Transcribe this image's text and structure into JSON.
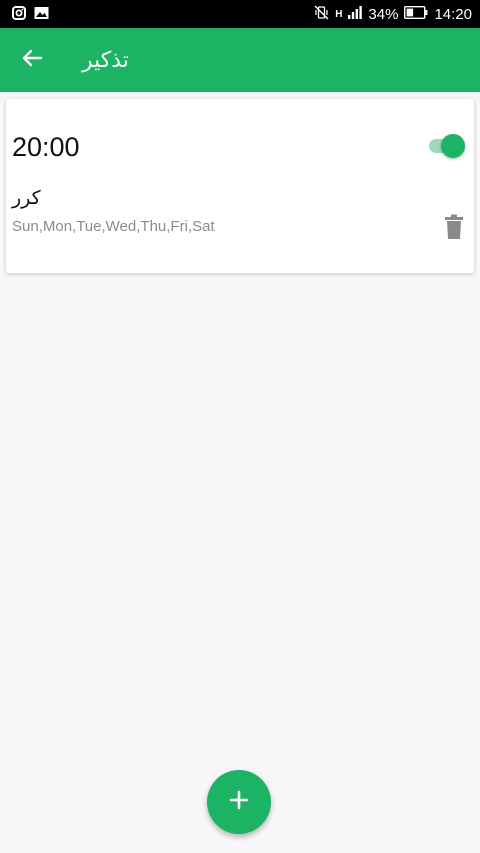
{
  "status_bar": {
    "left_icons": [
      "instagram-icon",
      "image-icon"
    ],
    "right_icons": [
      "mute-vibrate-icon",
      "signal-icon",
      "battery-icon"
    ],
    "network": "H",
    "battery": "34%",
    "time": "14:20"
  },
  "app_bar": {
    "title": "تذكير",
    "back_icon": "arrow-left-icon"
  },
  "reminder": {
    "time": "20:00",
    "enabled": true,
    "label": "كرر",
    "days": "Sun,Mon,Tue,Wed,Thu,Fri,Sat",
    "delete_icon": "trash-icon"
  },
  "fab": {
    "icon": "plus-icon"
  },
  "colors": {
    "primary": "#1db364",
    "toggle_track": "#9ddbb8",
    "background": "#f7f7f7",
    "card": "#ffffff",
    "secondary_text": "#8c8c8c",
    "icon_gray": "#8a8a8a"
  }
}
